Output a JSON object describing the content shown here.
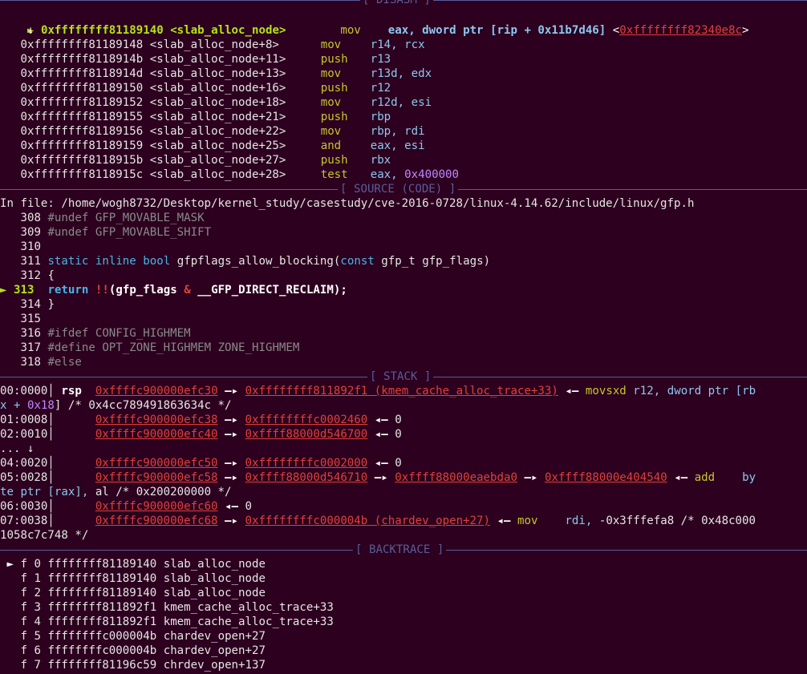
{
  "sections": {
    "disasm": "[ DISASM ]",
    "source": "[ SOURCE (CODE) ]",
    "stack": "[ STACK ]",
    "backtrace": "[ BACKTRACE ]"
  },
  "disasm": {
    "current": {
      "marker": "►",
      "addr": "0xffffffff81189140",
      "sym": "<slab_alloc_node>",
      "mnem": "mov",
      "operands": "eax, dword ptr [rip + 0x11b7d46]",
      "target": "0xffffffff82340e8c"
    },
    "down_arrow": "↓",
    "rows": [
      {
        "addr": "0xffffffff81189148",
        "sym": "<slab_alloc_node+8>",
        "mnem": "mov",
        "ops": "r14, rcx"
      },
      {
        "addr": "0xffffffff8118914b",
        "sym": "<slab_alloc_node+11>",
        "mnem": "push",
        "ops": "r13"
      },
      {
        "addr": "0xffffffff8118914d",
        "sym": "<slab_alloc_node+13>",
        "mnem": "mov",
        "ops": "r13d, edx"
      },
      {
        "addr": "0xffffffff81189150",
        "sym": "<slab_alloc_node+16>",
        "mnem": "push",
        "ops": "r12"
      },
      {
        "addr": "0xffffffff81189152",
        "sym": "<slab_alloc_node+18>",
        "mnem": "mov",
        "ops": "r12d, esi"
      },
      {
        "addr": "0xffffffff81189155",
        "sym": "<slab_alloc_node+21>",
        "mnem": "push",
        "ops": "rbp"
      },
      {
        "addr": "0xffffffff81189156",
        "sym": "<slab_alloc_node+22>",
        "mnem": "mov",
        "ops": "rbp, rdi"
      },
      {
        "addr": "0xffffffff81189159",
        "sym": "<slab_alloc_node+25>",
        "mnem": "and",
        "ops": "eax, esi"
      },
      {
        "addr": "0xffffffff8118915b",
        "sym": "<slab_alloc_node+27>",
        "mnem": "push",
        "ops": "rbx"
      },
      {
        "addr": "0xffffffff8118915c",
        "sym": "<slab_alloc_node+28>",
        "mnem": "test",
        "ops": "eax, 0x400000"
      }
    ]
  },
  "source": {
    "file": "In file: /home/wogh8732/Desktop/kernel_study/casestudy/cve-2016-0728/linux-4.14.62/include/linux/gfp.h",
    "lines": [
      {
        "n": "308",
        "text": "#undef GFP_MOVABLE_MASK"
      },
      {
        "n": "309",
        "text": "#undef GFP_MOVABLE_SHIFT"
      },
      {
        "n": "310",
        "text": ""
      },
      {
        "n": "311",
        "kw1": "static",
        "kw2": "inline",
        "kw3": "bool",
        "rest": " gfpflags_allow_blocking(",
        "kw4": "const",
        "rest2": " gfp_t gfp_flags)"
      },
      {
        "n": "312",
        "text": "{"
      },
      {
        "n": "313",
        "marker": "►",
        "ret": "return",
        "bang": "!!",
        "a": "(gfp_flags ",
        "amp": "&",
        "b": " __GFP_DIRECT_RECLAIM);"
      },
      {
        "n": "314",
        "text": "}"
      },
      {
        "n": "315",
        "text": ""
      },
      {
        "n": "316",
        "text": "#ifdef CONFIG_HIGHMEM"
      },
      {
        "n": "317",
        "text": "#define OPT_ZONE_HIGHMEM ZONE_HIGHMEM"
      },
      {
        "n": "318",
        "text": "#else"
      }
    ]
  },
  "stack": {
    "r0": {
      "off": "00:0000",
      "reg": "rsp",
      "p1": "0xffffc900000efc30",
      "arrow": "—▸",
      "p2": "0xffffffff811892f1 (kmem_cache_alloc_trace+33)",
      "back": "◂—",
      "mn": "movsxd",
      "ops1": "r12,",
      "ops2": "dword ptr",
      "ops3": "[rb"
    },
    "r0b": {
      "a": "x + ",
      "b": "0x18",
      "c": "] /* 0x4cc789491863634c */"
    },
    "r1": {
      "off": "01:0008",
      "p1": "0xffffc900000efc38",
      "p2": "0xffffffffc0002460",
      "val": "0"
    },
    "r2": {
      "off": "02:0010",
      "p1": "0xffffc900000efc40",
      "p2": "0xffff88000d546700",
      "val": "0"
    },
    "dots": "... ↓",
    "r4": {
      "off": "04:0020",
      "p1": "0xffffc900000efc50",
      "p2": "0xffffffffc0002000",
      "val": "0"
    },
    "r5": {
      "off": "05:0028",
      "p1": "0xffffc900000efc58",
      "p2": "0xffff88000d546710",
      "p3": "0xffff88000eaebda0",
      "p4": "0xffff88000e404540",
      "mn": "add",
      "ops": "by"
    },
    "r5b": {
      "a": "te ptr ",
      "b": "[rax],",
      "c": " al /* 0x200200000 */"
    },
    "r6": {
      "off": "06:0030",
      "p1": "0xffffc900000efc60",
      "val": "0"
    },
    "r7": {
      "off": "07:0038",
      "p1": "0xffffc900000efc68",
      "p2": "0xffffffffc000004b (chardev_open+27)",
      "mn": "mov",
      "ops1": "rdi,",
      "ops2": " -0x3fffefa8",
      "ops3": " /* 0x48c000"
    },
    "r7b": "1058c7c748 */"
  },
  "backtrace": [
    {
      "marker": "►",
      "f": "f 0",
      "addr": "ffffffff81189140",
      "sym": "slab_alloc_node"
    },
    {
      "f": "f 1",
      "addr": "ffffffff81189140",
      "sym": "slab_alloc_node"
    },
    {
      "f": "f 2",
      "addr": "ffffffff81189140",
      "sym": "slab_alloc_node"
    },
    {
      "f": "f 3",
      "addr": "ffffffff811892f1",
      "sym": "kmem_cache_alloc_trace+33"
    },
    {
      "f": "f 4",
      "addr": "ffffffff811892f1",
      "sym": "kmem_cache_alloc_trace+33"
    },
    {
      "f": "f 5",
      "addr": "ffffffffc000004b",
      "sym": "chardev_open+27"
    },
    {
      "f": "f 6",
      "addr": "ffffffffc000004b",
      "sym": "chardev_open+27"
    },
    {
      "f": "f 7",
      "addr": "ffffffff81196c59",
      "sym": "chrdev_open+137"
    }
  ]
}
